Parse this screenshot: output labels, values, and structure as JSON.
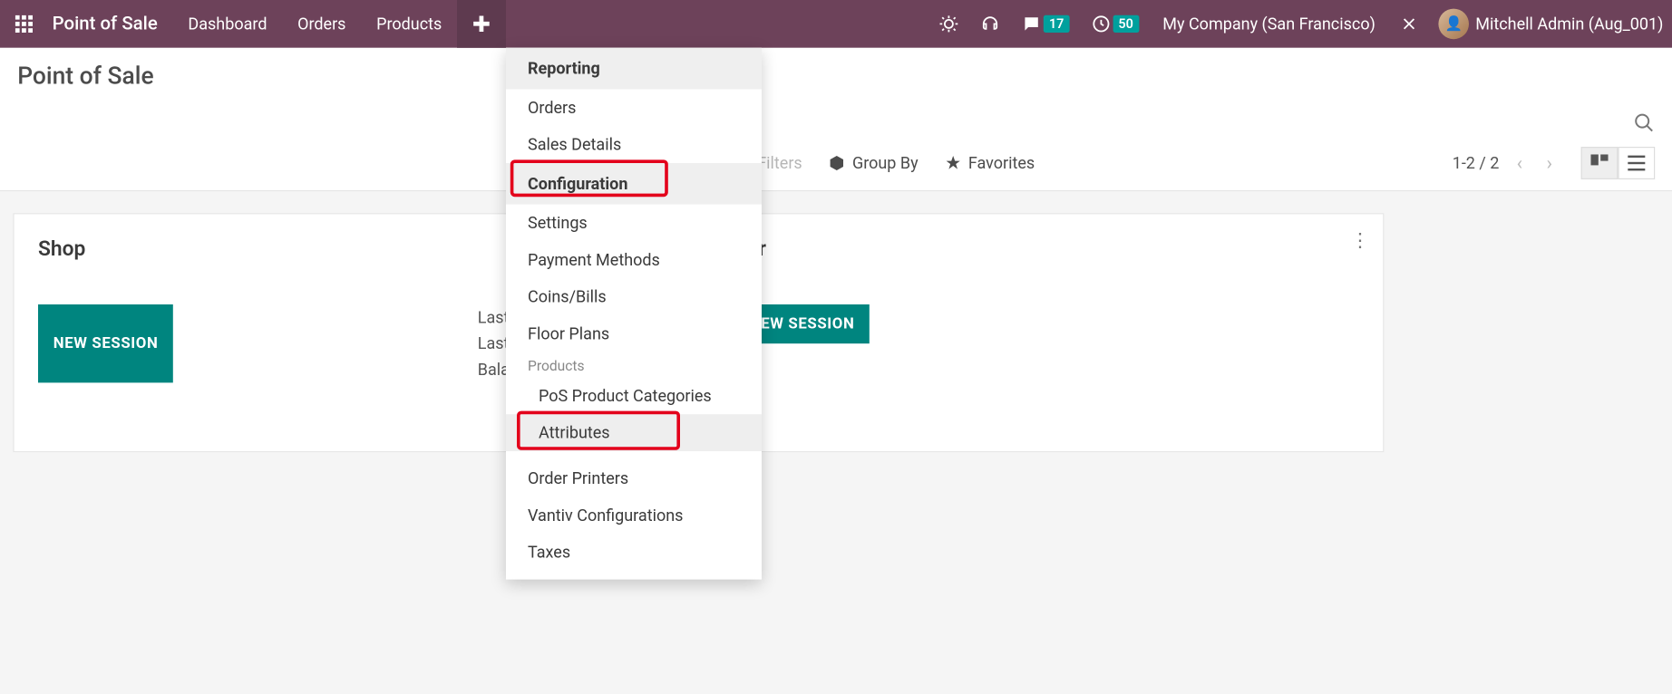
{
  "topnav": {
    "brand": "Point of Sale",
    "items": [
      "Dashboard",
      "Orders",
      "Products"
    ],
    "msg_badge": "17",
    "clock_badge": "50",
    "company": "My Company (San Francisco)",
    "user": "Mitchell Admin (Aug_001)"
  },
  "header": {
    "title": "Point of Sale",
    "search_placeholder": "Search...",
    "filters": "Filters",
    "group_by": "Group By",
    "favorites": "Favorites",
    "pager": "1-2 / 2"
  },
  "dropdown": {
    "section1": "Reporting",
    "s1_items": [
      "Orders",
      "Sales Details"
    ],
    "section2": "Configuration",
    "s2_items": [
      "Settings",
      "Payment Methods",
      "Coins/Bills",
      "Floor Plans"
    ],
    "sub_products": "Products",
    "s2b_items": [
      "PoS Product Categories",
      "Attributes"
    ],
    "s2c_items": [
      "Order Printers",
      "Vantiv Configurations",
      "Taxes"
    ]
  },
  "cards": [
    {
      "title": "Shop",
      "button": "NEW SESSION",
      "info1": "Last Closing Date",
      "info2": "Last Closing Cash Balance"
    },
    {
      "title": "Bar",
      "button": "NEW SESSION",
      "info1": "",
      "info2": ""
    }
  ]
}
